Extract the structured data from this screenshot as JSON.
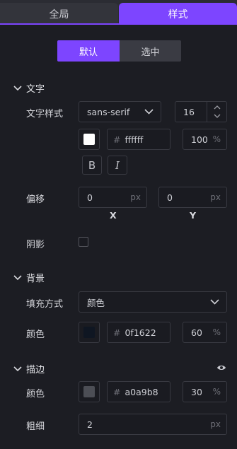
{
  "tabs": {
    "global": "全局",
    "style": "样式"
  },
  "state_toggle": {
    "default": "默认",
    "selected": "选中"
  },
  "text_section": {
    "title": "文字",
    "font_style_label": "文字样式",
    "font_family": "sans-serif",
    "font_size": "16",
    "color_hash": "#",
    "color_hex": "ffffff",
    "color_swatch": "#ffffff",
    "opacity": "100",
    "percent_unit": "%",
    "bold_label": "B",
    "italic_label": "I",
    "offset_label": "偏移",
    "offset_x": "0",
    "offset_y": "0",
    "px_unit": "px",
    "x_axis": "X",
    "y_axis": "Y",
    "shadow_label": "阴影"
  },
  "background_section": {
    "title": "背景",
    "fill_label": "填充方式",
    "fill_value": "颜色",
    "color_label": "颜色",
    "color_hash": "#",
    "color_hex": "0f1622",
    "color_swatch": "#0f1622",
    "opacity": "60",
    "percent_unit": "%"
  },
  "stroke_section": {
    "title": "描边",
    "color_label": "颜色",
    "color_hash": "#",
    "color_hex": "a0a9b8",
    "color_swatch": "#a0a9b8",
    "opacity": "30",
    "percent_unit": "%",
    "thickness_label": "粗细",
    "thickness": "2",
    "px_unit": "px"
  },
  "icons": [
    "chevron-down-icon",
    "chevron-up-icon",
    "eye-icon",
    "italic-icon",
    "bold-icon"
  ]
}
